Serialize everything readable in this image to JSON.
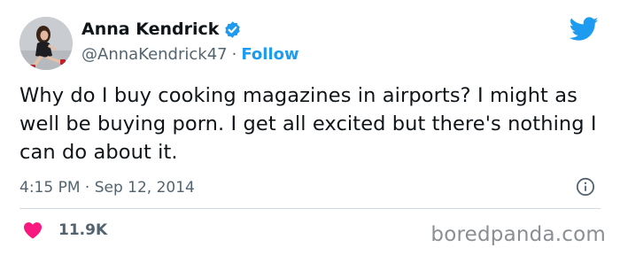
{
  "author": {
    "name": "Anna Kendrick",
    "handle": "@AnnaKendrick47",
    "separator": "·",
    "follow_label": "Follow"
  },
  "tweet": {
    "text": "Why do I buy cooking magazines in airports? I might as well be buying porn. I get all excited but there's nothing I can do about it.",
    "timestamp": "4:15 PM · Sep 12, 2014"
  },
  "engagement": {
    "likes": "11.9K"
  },
  "watermark": "boredpanda.com",
  "icons": {
    "verified": "verified-badge-icon",
    "platform": "twitter-bird-icon",
    "info": "info-icon",
    "like": "heart-icon"
  },
  "colors": {
    "accent": "#1d9bf0",
    "like": "#f91880",
    "secondary_text": "#536471"
  }
}
